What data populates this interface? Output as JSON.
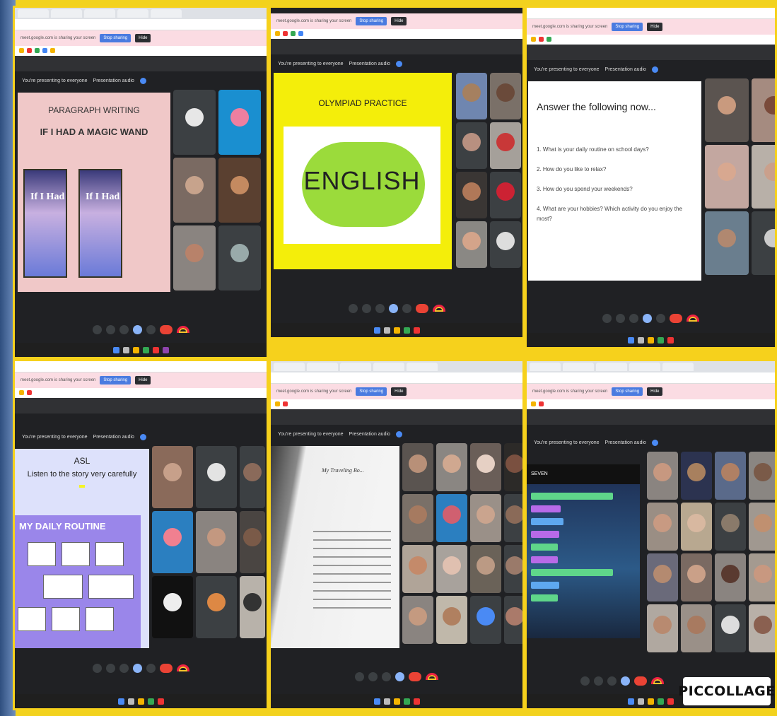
{
  "screens": [
    {
      "slide_title": "PARAGRAPH WRITING",
      "slide_subtitle": "IF I HAD A MAGIC WAND",
      "book_label": "If I Had",
      "presenting_label": "You're presenting to everyone",
      "presentation_audio": "Presentation audio"
    },
    {
      "slide_title": "OLYMPIAD PRACTICE",
      "slide_word": "ENGLISH",
      "presenting_label": "You're presenting to everyone",
      "presentation_audio": "Presentation audio"
    },
    {
      "slide_title": "Answer the following now...",
      "questions": [
        "1. What is your daily routine on school days?",
        "2. How do you like to relax?",
        "3. How do you spend your weekends?",
        "4. What are your hobbies? Which activity do you enjoy the most?"
      ],
      "presenting_label": "You're presenting to everyone",
      "presentation_audio": "Presentation audio"
    },
    {
      "slide_title": "ASL",
      "slide_instruction": "Listen to the story very carefully",
      "routine_title": "MY DAILY ROUTINE",
      "presenting_label": "You're presenting to everyone",
      "presentation_audio": "Presentation audio"
    },
    {
      "book_page_title": "My Traveling Bo...",
      "presenting_label": "You're presenting to everyone",
      "presentation_audio": "Presentation audio"
    },
    {
      "game_title": "SEVEN",
      "presenting_label": "You're presenting to everyone",
      "presentation_audio": "Presentation audio"
    }
  ],
  "browser": {
    "share_banner": "meet.google.com is sharing your screen",
    "stop_sharing": "Stop sharing",
    "hide": "Hide"
  },
  "brand": "PICCOLLAGE",
  "colors": {
    "frame": "#f6d11c",
    "meet_bg": "#202124",
    "end_call": "#ea4335",
    "slide2_bg": "#f4ee0a"
  }
}
